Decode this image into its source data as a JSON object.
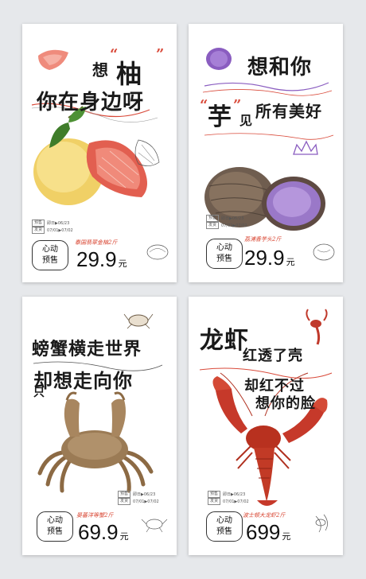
{
  "posters": [
    {
      "headline_lines": [
        "想",
        "柚",
        "你在身边呀"
      ],
      "info": {
        "presale_label": "预售",
        "presale_date": "即日▶06/23",
        "ship_label": "发货",
        "ship_date": "07/01▶07/02"
      },
      "badge": {
        "line1": "心动",
        "line2": "预售"
      },
      "product": "泰国翡翠金柚2斤",
      "price": "29.9",
      "unit": "元"
    },
    {
      "headline_lines": [
        "想和你",
        "芋",
        "见",
        "所有美好"
      ],
      "info": {
        "presale_label": "预售",
        "presale_date": "即日▶06/23",
        "ship_label": "发货",
        "ship_date": "07/01▶07/02"
      },
      "badge": {
        "line1": "心动",
        "line2": "预售"
      },
      "product": "荔浦香芋头2斤",
      "price": "29.9",
      "unit": "元"
    },
    {
      "headline_lines": [
        "螃蟹横走世界",
        "却想走向你",
        "只"
      ],
      "info": {
        "presale_label": "预售",
        "presale_date": "即日▶06/23",
        "ship_label": "发货",
        "ship_date": "07/01▶07/02"
      },
      "badge": {
        "line1": "心动",
        "line2": "预售"
      },
      "product": "晏蕃洋等蟹2斤",
      "price": "69.9",
      "unit": "元"
    },
    {
      "headline_lines": [
        "龙虾",
        "红透了壳",
        "却红不过",
        "想你的脸"
      ],
      "info": {
        "presale_label": "预售",
        "presale_date": "即日▶06/23",
        "ship_label": "发货",
        "ship_date": "07/01▶07/02"
      },
      "badge": {
        "line1": "心动",
        "line2": "预售"
      },
      "product": "波士顿大龙虾2斤",
      "price": "699",
      "unit": "元"
    }
  ],
  "quote_mark": "“”",
  "colors": {
    "accent": "#d94a3a",
    "purple": "#8a5dc0",
    "background": "#e6e8eb"
  }
}
